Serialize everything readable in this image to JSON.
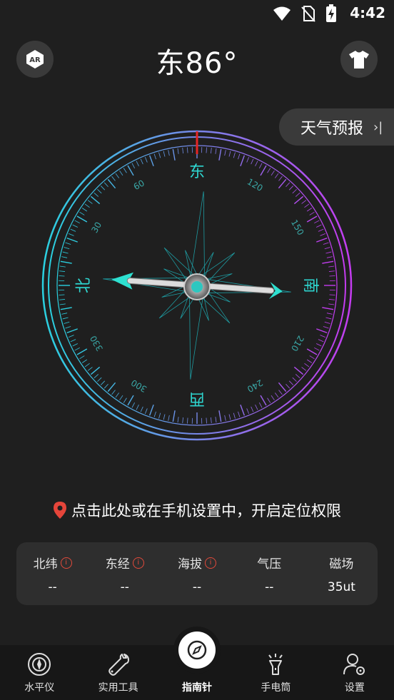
{
  "status": {
    "time": "4:42"
  },
  "header": {
    "ar_label": "AR",
    "heading": "东86°"
  },
  "weather": {
    "label": "天气预报",
    "chevron": "›|"
  },
  "compass": {
    "directions": {
      "north": "北",
      "east": "东",
      "south": "南",
      "west": "西"
    },
    "tick_labels": [
      "30",
      "60",
      "120",
      "150",
      "210",
      "240",
      "300",
      "330"
    ],
    "ring_colors": {
      "start": "#2ad1e0",
      "end": "#c43cf0"
    },
    "needle_color": "#2ee0d0",
    "marker_color": "#e52525"
  },
  "location": {
    "text": "点击此处或在手机设置中，开启定位权限",
    "pin_color": "#e5453a"
  },
  "info": [
    {
      "label": "北纬",
      "value": "--",
      "warn": true
    },
    {
      "label": "东经",
      "value": "--",
      "warn": true
    },
    {
      "label": "海拔",
      "value": "--",
      "warn": true
    },
    {
      "label": "气压",
      "value": "--",
      "warn": false
    },
    {
      "label": "磁场",
      "value": "35ut",
      "warn": false
    }
  ],
  "nav": [
    {
      "label": "水平仪",
      "icon": "level-icon"
    },
    {
      "label": "实用工具",
      "icon": "wrench-icon"
    },
    {
      "label": "指南针",
      "icon": "compass-icon",
      "active": true
    },
    {
      "label": "手电筒",
      "icon": "flashlight-icon"
    },
    {
      "label": "设置",
      "icon": "settings-user-icon"
    }
  ]
}
